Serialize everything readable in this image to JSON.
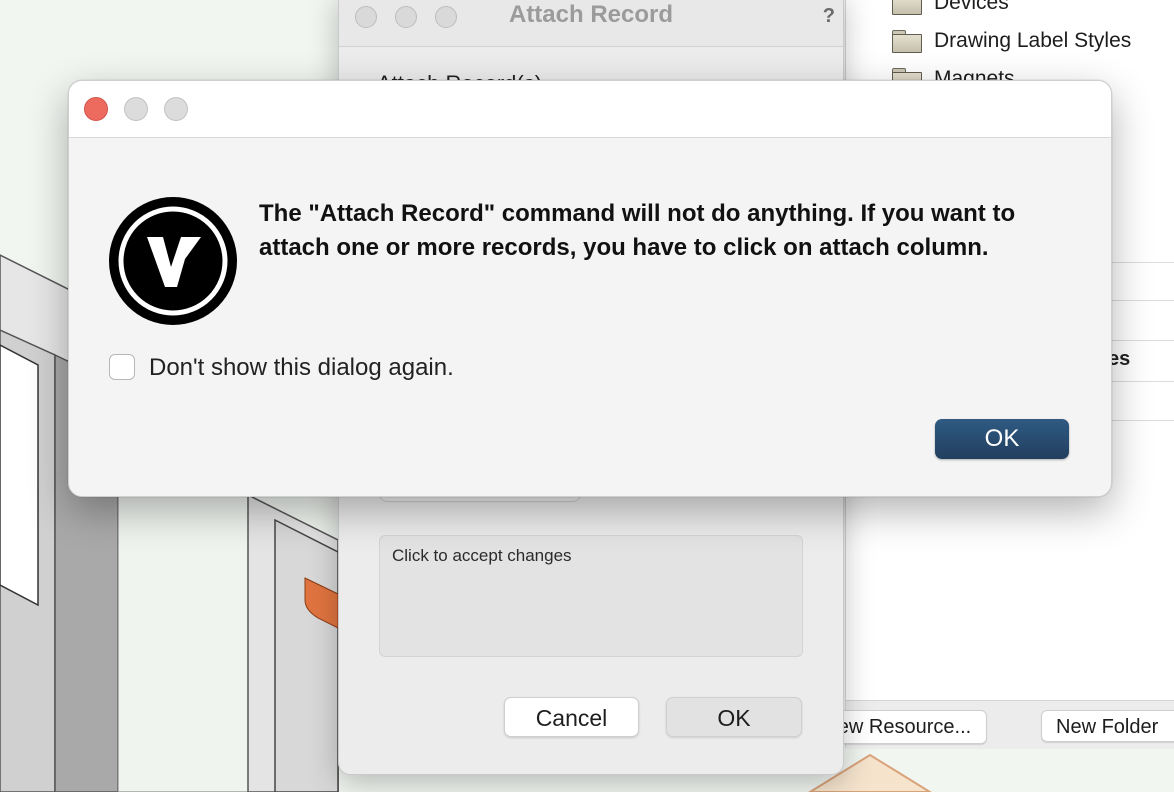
{
  "resource_browser": {
    "folders": [
      "Devices",
      "Drawing Label Styles",
      "Magnets"
    ],
    "partial_label": "es",
    "buttons": {
      "new_resource": "ew Resource...",
      "new_folder": "New Folder"
    }
  },
  "attach_dialog": {
    "title": "Attach Record",
    "help_glyph": "?",
    "section_label": "Attach Record(s)",
    "help_text": "Click to accept changes",
    "cancel_label": "Cancel",
    "ok_label": "OK"
  },
  "alert": {
    "message": "The \"Attach Record\" command will not do anything. If you want to attach one or more records, you have to click on attach column.",
    "checkbox_label": "Don't show this dialog again.",
    "checkbox_checked": false,
    "ok_label": "OK",
    "accent_color": "#2a4d72",
    "logo_icon": "vectorworks-logo-icon"
  }
}
